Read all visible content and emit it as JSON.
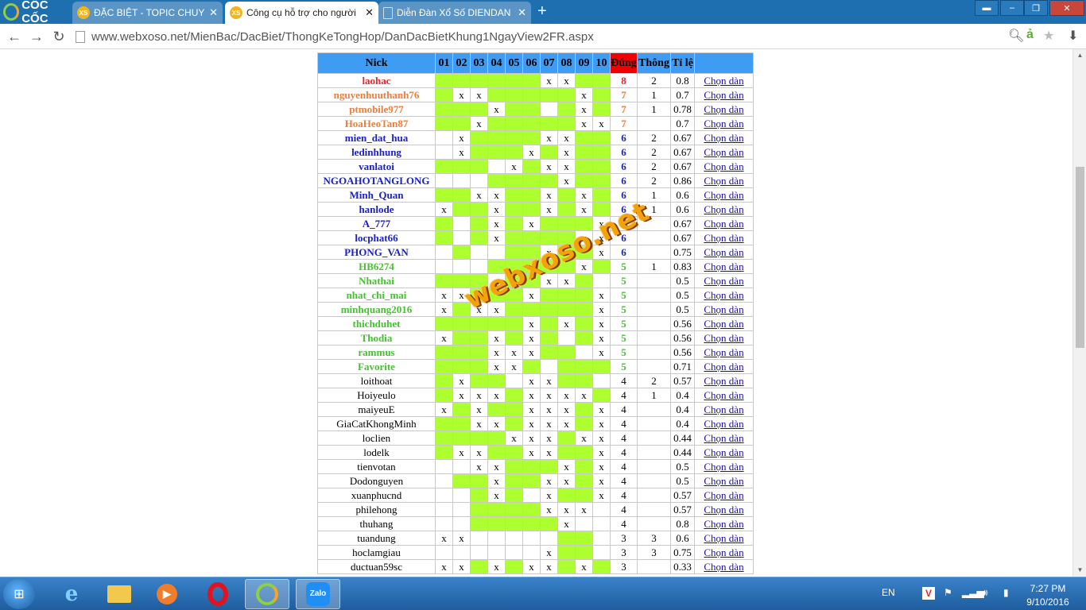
{
  "browser": {
    "brand": "CỐC CỐC",
    "tabs": [
      {
        "title": "ĐẶC BIỆT - TOPIC CHUYÊN",
        "favicon": "XS",
        "state": "inactive"
      },
      {
        "title": "Công cụ hỗ trợ cho người",
        "favicon": "XS",
        "state": "active"
      },
      {
        "title": "Diễn Đàn Xổ Số DIENDAN",
        "favicon": "",
        "state": "inactive"
      }
    ],
    "url": "www.webxoso.net/MienBac/DacBiet/ThongKeTongHop/DanDacBietKhung1NgayView2FR.aspx"
  },
  "table": {
    "headers": {
      "nick": "Nick",
      "numbers": [
        "01",
        "02",
        "03",
        "04",
        "05",
        "06",
        "07",
        "08",
        "09",
        "10"
      ],
      "hits": "Đúng",
      "info": "Thông",
      "ratio": "Tỉ lệ",
      "action": ""
    },
    "action_label": "Chọn dàn",
    "rows": [
      {
        "nick": "laohac",
        "color": "#e8262b",
        "bold": true,
        "on": [
          1,
          1,
          1,
          1,
          1,
          1,
          0,
          0,
          1,
          1
        ],
        "marks": [
          "",
          "",
          "",
          "",
          "",
          "",
          "x",
          "x",
          "",
          ""
        ],
        "hits": "8",
        "info": "2",
        "ratio": "0.8"
      },
      {
        "nick": "nguyenhuuthanh76",
        "color": "#f07d3b",
        "bold": true,
        "on": [
          1,
          0,
          0,
          1,
          1,
          1,
          1,
          1,
          0,
          1
        ],
        "marks": [
          "",
          "x",
          "x",
          "",
          "",
          "",
          "",
          "",
          "x",
          ""
        ],
        "hits": "7",
        "info": "1",
        "ratio": "0.7"
      },
      {
        "nick": "ptmobile977",
        "color": "#f07d3b",
        "bold": true,
        "on": [
          1,
          1,
          1,
          0,
          1,
          1,
          0,
          1,
          0,
          1
        ],
        "marks": [
          "",
          "",
          "",
          "x",
          "",
          "",
          "",
          "",
          "x",
          ""
        ],
        "hits": "7",
        "info": "1",
        "ratio": "0.78"
      },
      {
        "nick": "HoaHeoTan87",
        "color": "#f07d3b",
        "bold": true,
        "on": [
          1,
          1,
          0,
          1,
          1,
          1,
          1,
          1,
          0,
          0
        ],
        "marks": [
          "",
          "",
          "x",
          "",
          "",
          "",
          "",
          "",
          "x",
          "x"
        ],
        "hits": "7",
        "info": "",
        "ratio": "0.7"
      },
      {
        "nick": "mien_dat_hua",
        "color": "#1a22c8",
        "bold": true,
        "on": [
          0,
          0,
          1,
          1,
          1,
          1,
          0,
          0,
          1,
          1
        ],
        "marks": [
          "",
          "x",
          "",
          "",
          "",
          "",
          "x",
          "x",
          "",
          ""
        ],
        "hits": "6",
        "info": "2",
        "ratio": "0.67"
      },
      {
        "nick": "ledinhhung",
        "color": "#1a22c8",
        "bold": true,
        "on": [
          0,
          0,
          1,
          1,
          1,
          0,
          1,
          0,
          1,
          1
        ],
        "marks": [
          "",
          "x",
          "",
          "",
          "",
          "x",
          "",
          "x",
          "",
          ""
        ],
        "hits": "6",
        "info": "2",
        "ratio": "0.67"
      },
      {
        "nick": "vanlatoi",
        "color": "#1a22c8",
        "bold": true,
        "on": [
          1,
          1,
          1,
          0,
          0,
          1,
          0,
          0,
          1,
          1
        ],
        "marks": [
          "",
          "",
          "",
          "",
          "x",
          "",
          "x",
          "x",
          "",
          ""
        ],
        "hits": "6",
        "info": "2",
        "ratio": "0.67"
      },
      {
        "nick": "NGOAHOTANGLONG",
        "color": "#1a22c8",
        "bold": true,
        "on": [
          0,
          0,
          0,
          1,
          1,
          1,
          1,
          0,
          1,
          1
        ],
        "marks": [
          "",
          "",
          "",
          "",
          "",
          "",
          "",
          "x",
          "",
          ""
        ],
        "hits": "6",
        "info": "2",
        "ratio": "0.86"
      },
      {
        "nick": "Minh_Quan",
        "color": "#1a22c8",
        "bold": true,
        "on": [
          1,
          1,
          0,
          0,
          1,
          1,
          0,
          1,
          0,
          1
        ],
        "marks": [
          "",
          "",
          "x",
          "x",
          "",
          "",
          "x",
          "",
          "x",
          ""
        ],
        "hits": "6",
        "info": "1",
        "ratio": "0.6"
      },
      {
        "nick": "hanlode",
        "color": "#1a22c8",
        "bold": true,
        "on": [
          0,
          1,
          1,
          0,
          1,
          1,
          0,
          1,
          0,
          1
        ],
        "marks": [
          "x",
          "",
          "",
          "x",
          "",
          "",
          "x",
          "",
          "x",
          ""
        ],
        "hits": "6",
        "info": "1",
        "ratio": "0.6"
      },
      {
        "nick": "A_777",
        "color": "#1a22c8",
        "bold": true,
        "on": [
          1,
          0,
          1,
          0,
          1,
          0,
          1,
          1,
          1,
          0
        ],
        "marks": [
          "",
          "",
          "",
          "x",
          "",
          "x",
          "",
          "",
          "",
          "x"
        ],
        "hits": "6",
        "info": "",
        "ratio": "0.67"
      },
      {
        "nick": "locphat66",
        "color": "#1a22c8",
        "bold": true,
        "on": [
          1,
          0,
          1,
          0,
          1,
          1,
          1,
          1,
          0,
          0
        ],
        "marks": [
          "",
          "",
          "",
          "x",
          "",
          "",
          "",
          "",
          "x",
          "x"
        ],
        "hits": "6",
        "info": "",
        "ratio": "0.67"
      },
      {
        "nick": "PHONG_VAN",
        "color": "#1a22c8",
        "bold": true,
        "on": [
          0,
          1,
          0,
          0,
          1,
          1,
          0,
          1,
          1,
          0
        ],
        "marks": [
          "",
          "",
          "",
          "",
          "",
          "",
          "x",
          "",
          "",
          "x"
        ],
        "hits": "6",
        "info": "",
        "ratio": "0.75"
      },
      {
        "nick": "HB6274",
        "color": "#46c231",
        "bold": true,
        "on": [
          0,
          0,
          0,
          1,
          1,
          1,
          1,
          1,
          0,
          1
        ],
        "marks": [
          "",
          "",
          "",
          "",
          "",
          "",
          "",
          "",
          "x",
          ""
        ],
        "hits": "5",
        "info": "1",
        "ratio": "0.83"
      },
      {
        "nick": "Nhathai",
        "color": "#46c231",
        "bold": true,
        "on": [
          1,
          1,
          1,
          0,
          1,
          1,
          0,
          0,
          1,
          0
        ],
        "marks": [
          "",
          "",
          "",
          "x",
          "",
          "",
          "x",
          "x",
          "",
          ""
        ],
        "hits": "5",
        "info": "",
        "ratio": "0.5"
      },
      {
        "nick": "nhat_chi_mai",
        "color": "#46c231",
        "bold": true,
        "on": [
          0,
          0,
          1,
          1,
          1,
          0,
          1,
          1,
          1,
          0
        ],
        "marks": [
          "x",
          "x",
          "",
          "",
          "",
          "x",
          "",
          "",
          "",
          "x"
        ],
        "hits": "5",
        "info": "",
        "ratio": "0.5"
      },
      {
        "nick": "minhquang2016",
        "color": "#46c231",
        "bold": true,
        "on": [
          0,
          1,
          0,
          0,
          1,
          1,
          1,
          1,
          1,
          0
        ],
        "marks": [
          "x",
          "",
          "x",
          "x",
          "",
          "",
          "",
          "",
          "",
          "x"
        ],
        "hits": "5",
        "info": "",
        "ratio": "0.5"
      },
      {
        "nick": "thichduhet",
        "color": "#46c231",
        "bold": true,
        "on": [
          1,
          1,
          1,
          1,
          1,
          0,
          1,
          0,
          1,
          0
        ],
        "marks": [
          "",
          "",
          "",
          "",
          "",
          "x",
          "",
          "x",
          "",
          "x"
        ],
        "hits": "5",
        "info": "",
        "ratio": "0.56"
      },
      {
        "nick": "Thodia",
        "color": "#46c231",
        "bold": true,
        "on": [
          0,
          1,
          1,
          0,
          1,
          0,
          1,
          0,
          1,
          0
        ],
        "marks": [
          "x",
          "",
          "",
          "x",
          "",
          "x",
          "",
          "",
          "",
          "x"
        ],
        "hits": "5",
        "info": "",
        "ratio": "0.56"
      },
      {
        "nick": "rammus",
        "color": "#46c231",
        "bold": true,
        "on": [
          1,
          1,
          1,
          0,
          0,
          0,
          1,
          1,
          0,
          0
        ],
        "marks": [
          "",
          "",
          "",
          "x",
          "x",
          "x",
          "",
          "",
          "",
          "x"
        ],
        "hits": "5",
        "info": "",
        "ratio": "0.56"
      },
      {
        "nick": "Favorite",
        "color": "#46c231",
        "bold": true,
        "on": [
          1,
          1,
          1,
          0,
          0,
          1,
          0,
          1,
          1,
          1
        ],
        "marks": [
          "",
          "",
          "",
          "x",
          "x",
          "",
          "",
          "",
          "",
          ""
        ],
        "hits": "5",
        "info": "",
        "ratio": "0.71"
      },
      {
        "nick": "loithoat",
        "color": "#000",
        "bold": false,
        "on": [
          1,
          0,
          1,
          1,
          0,
          0,
          0,
          1,
          1,
          0
        ],
        "marks": [
          "",
          "x",
          "",
          "",
          "",
          "x",
          "x",
          "",
          "",
          ""
        ],
        "hits": "4",
        "info": "2",
        "ratio": "0.57"
      },
      {
        "nick": "Hoiyeulo",
        "color": "#000",
        "bold": false,
        "on": [
          1,
          0,
          0,
          0,
          1,
          0,
          0,
          0,
          0,
          1
        ],
        "marks": [
          "",
          "x",
          "x",
          "x",
          "",
          "x",
          "x",
          "x",
          "x",
          ""
        ],
        "hits": "4",
        "info": "1",
        "ratio": "0.4"
      },
      {
        "nick": "maiyeuE",
        "color": "#000",
        "bold": false,
        "on": [
          0,
          1,
          0,
          1,
          1,
          0,
          0,
          0,
          1,
          0
        ],
        "marks": [
          "x",
          "",
          "x",
          "",
          "",
          "x",
          "x",
          "x",
          "",
          "x"
        ],
        "hits": "4",
        "info": "",
        "ratio": "0.4"
      },
      {
        "nick": "GiaCatKhongMinh",
        "color": "#000",
        "bold": false,
        "on": [
          1,
          1,
          0,
          0,
          1,
          0,
          0,
          0,
          1,
          0
        ],
        "marks": [
          "",
          "",
          "x",
          "x",
          "",
          "x",
          "x",
          "x",
          "",
          "x"
        ],
        "hits": "4",
        "info": "",
        "ratio": "0.4"
      },
      {
        "nick": "loclien",
        "color": "#000",
        "bold": false,
        "on": [
          1,
          1,
          1,
          1,
          0,
          0,
          0,
          1,
          0,
          0
        ],
        "marks": [
          "",
          "",
          "",
          "",
          "x",
          "x",
          "x",
          "",
          "x",
          "x"
        ],
        "hits": "4",
        "info": "",
        "ratio": "0.44"
      },
      {
        "nick": "lodelk",
        "color": "#000",
        "bold": false,
        "on": [
          1,
          0,
          0,
          1,
          1,
          0,
          0,
          1,
          1,
          0
        ],
        "marks": [
          "",
          "x",
          "x",
          "",
          "",
          "x",
          "x",
          "",
          "",
          "x"
        ],
        "hits": "4",
        "info": "",
        "ratio": "0.44"
      },
      {
        "nick": "tienvotan",
        "color": "#000",
        "bold": false,
        "on": [
          0,
          0,
          0,
          0,
          1,
          1,
          1,
          0,
          1,
          0
        ],
        "marks": [
          "",
          "",
          "x",
          "x",
          "",
          "",
          "",
          "x",
          "",
          "x"
        ],
        "hits": "4",
        "info": "",
        "ratio": "0.5"
      },
      {
        "nick": "Dodonguyen",
        "color": "#000",
        "bold": false,
        "on": [
          0,
          1,
          1,
          0,
          1,
          1,
          0,
          0,
          1,
          0
        ],
        "marks": [
          "",
          "",
          "",
          "x",
          "",
          "",
          "x",
          "x",
          "",
          "x"
        ],
        "hits": "4",
        "info": "",
        "ratio": "0.5"
      },
      {
        "nick": "xuanphucnd",
        "color": "#000",
        "bold": false,
        "on": [
          0,
          0,
          1,
          0,
          1,
          0,
          0,
          1,
          1,
          0
        ],
        "marks": [
          "",
          "",
          "",
          "x",
          "",
          "",
          "x",
          "",
          "",
          "x"
        ],
        "hits": "4",
        "info": "",
        "ratio": "0.57"
      },
      {
        "nick": "philehong",
        "color": "#000",
        "bold": false,
        "on": [
          0,
          0,
          1,
          1,
          1,
          1,
          0,
          0,
          0,
          0
        ],
        "marks": [
          "",
          "",
          "",
          "",
          "",
          "",
          "x",
          "x",
          "x",
          ""
        ],
        "hits": "4",
        "info": "",
        "ratio": "0.57"
      },
      {
        "nick": "thuhang",
        "color": "#000",
        "bold": false,
        "on": [
          0,
          0,
          1,
          1,
          1,
          1,
          1,
          0,
          0,
          0
        ],
        "marks": [
          "",
          "",
          "",
          "",
          "",
          "",
          "",
          "x",
          "",
          ""
        ],
        "hits": "4",
        "info": "",
        "ratio": "0.8"
      },
      {
        "nick": "tuandung",
        "color": "#000",
        "bold": false,
        "on": [
          0,
          0,
          0,
          0,
          0,
          0,
          0,
          1,
          1,
          0
        ],
        "marks": [
          "x",
          "x",
          "",
          "",
          "",
          "",
          "",
          "",
          "",
          ""
        ],
        "hits": "3",
        "info": "3",
        "ratio": "0.6"
      },
      {
        "nick": "hoclamgiau",
        "color": "#000",
        "bold": false,
        "on": [
          0,
          0,
          0,
          0,
          0,
          0,
          0,
          1,
          1,
          0
        ],
        "marks": [
          "",
          "",
          "",
          "",
          "",
          "",
          "x",
          "",
          "",
          ""
        ],
        "hits": "3",
        "info": "3",
        "ratio": "0.75"
      },
      {
        "nick": "ductuan59sc",
        "color": "#000",
        "bold": false,
        "on": [
          0,
          0,
          1,
          0,
          1,
          0,
          0,
          1,
          0,
          1
        ],
        "marks": [
          "x",
          "x",
          "",
          "x",
          "",
          "x",
          "x",
          "",
          "x",
          ""
        ],
        "hits": "3",
        "info": "",
        "ratio": "0.33"
      }
    ]
  },
  "watermark": "webxoso.net",
  "taskbar": {
    "language": "EN",
    "time": "7:27 PM",
    "date": "9/10/2016",
    "apps": [
      "internet-explorer",
      "file-explorer",
      "media-player",
      "opera",
      "coccoc",
      "zalo"
    ],
    "zalo_label": "Zalo"
  }
}
